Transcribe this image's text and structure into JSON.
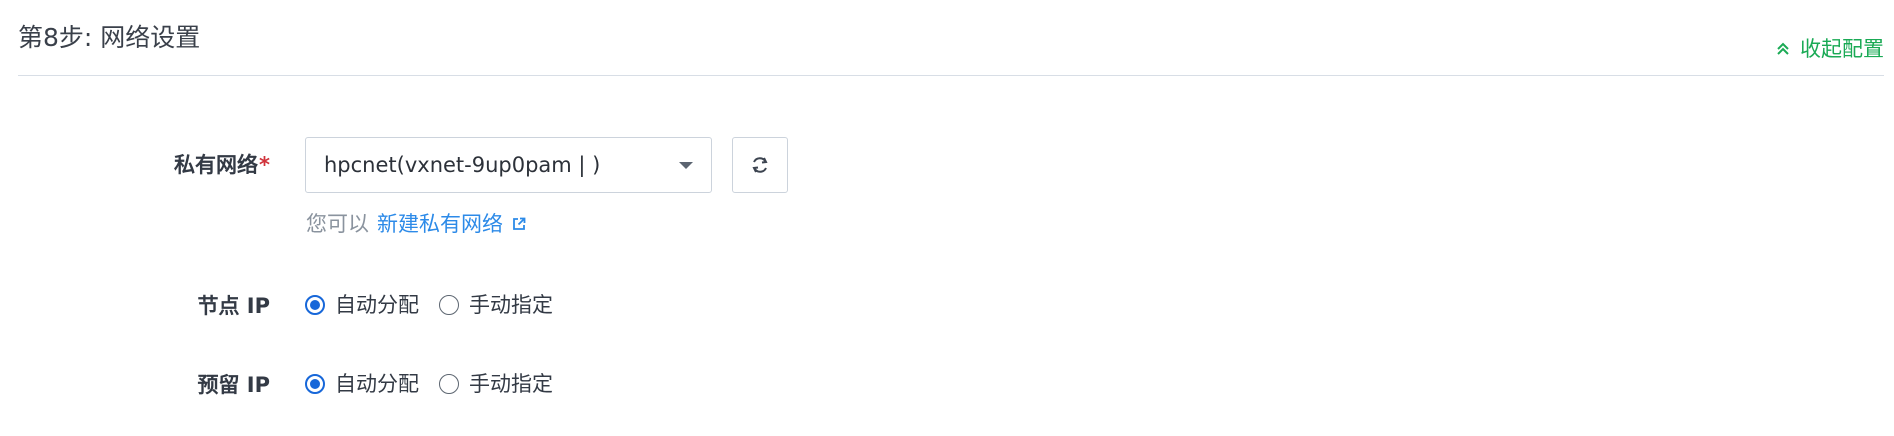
{
  "step": {
    "title": "第8步: 网络设置",
    "collapse_label": "收起配置"
  },
  "private_network": {
    "label": "私有网络",
    "required_mark": "*",
    "selected_value": "hpcnet(vxnet-9up0pam | )",
    "hint_prefix": "您可以",
    "hint_link": "新建私有网络"
  },
  "node_ip": {
    "label": "节点 IP",
    "options": [
      {
        "label": "自动分配",
        "checked": true
      },
      {
        "label": "手动指定",
        "checked": false
      }
    ]
  },
  "reserved_ip": {
    "label": "预留 IP",
    "options": [
      {
        "label": "自动分配",
        "checked": true
      },
      {
        "label": "手动指定",
        "checked": false
      }
    ]
  },
  "colors": {
    "accent_green": "#1aaa55",
    "link_blue": "#2c8ae8",
    "radio_blue": "#1767d9",
    "required_red": "#d0333b"
  },
  "icons": {
    "collapse": "double-chevron-up-icon",
    "refresh": "refresh-icon",
    "external": "external-link-icon",
    "dropdown": "caret-down-icon"
  }
}
